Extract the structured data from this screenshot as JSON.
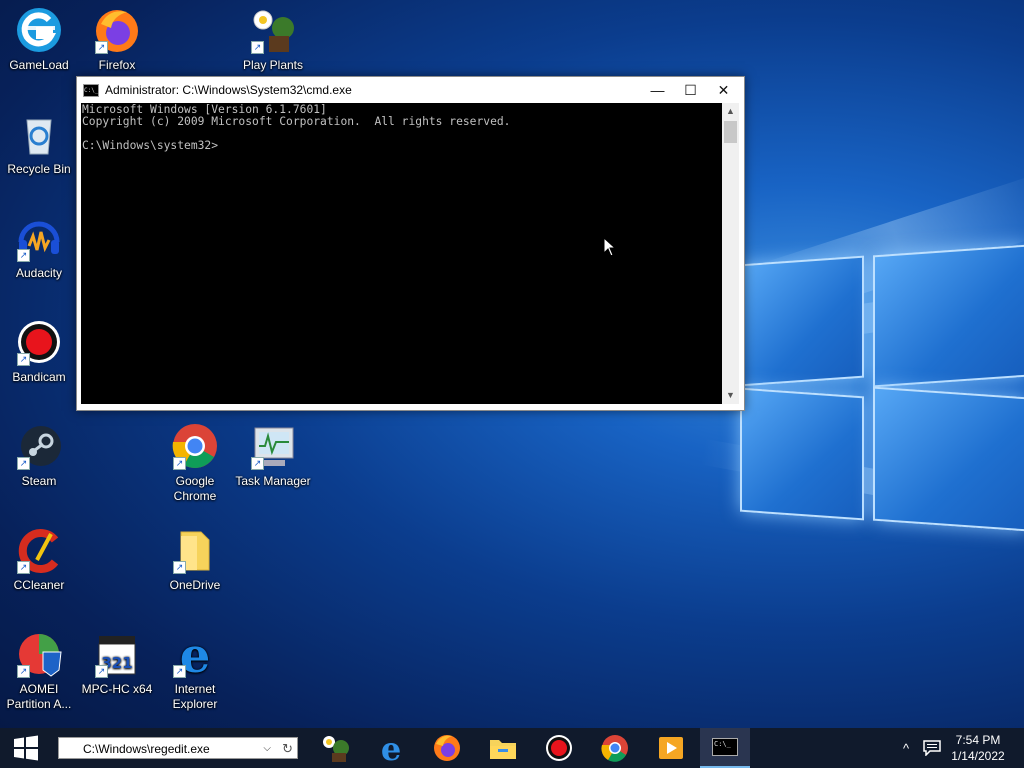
{
  "desktop": {
    "icons": [
      {
        "label": "GameLoad"
      },
      {
        "label": "Firefox"
      },
      {
        "label": "Play Plants vs."
      },
      {
        "label": "Recycle Bin"
      },
      {
        "label": "Audacity"
      },
      {
        "label": "Bandicam"
      },
      {
        "label": "Steam"
      },
      {
        "label": "Google Chrome"
      },
      {
        "label": "Task Manager"
      },
      {
        "label": "CCleaner"
      },
      {
        "label": "OneDrive"
      },
      {
        "label": "AOMEI Partition A..."
      },
      {
        "label": "MPC-HC x64"
      },
      {
        "label": "Internet Explorer"
      }
    ],
    "shortcut_glyph": "↗"
  },
  "cmd_window": {
    "title": "Administrator: C:\\Windows\\System32\\cmd.exe",
    "icon_text": "C:\\_",
    "minimize": "—",
    "maximize": "☐",
    "close": "✕",
    "lines": [
      "Microsoft Windows [Version 6.1.7601]",
      "Copyright (c) 2009 Microsoft Corporation.  All rights reserved.",
      "",
      "C:\\Windows\\system32>"
    ],
    "scroll_up": "▲",
    "scroll_down": "▼"
  },
  "taskbar": {
    "run_value": "C:\\Windows\\regedit.exe",
    "dropdown_glyph": "⌵",
    "refresh_glyph": "↻",
    "apps": [
      "Plants vs. Zombies",
      "Microsoft Edge",
      "Firefox",
      "File Explorer",
      "Bandicam",
      "Google Chrome",
      "MPC-HC",
      "Command Prompt"
    ],
    "cmd_icon_text": "C:\\_",
    "tray_chevron": "^",
    "time": "7:54 PM",
    "date": "1/14/2022"
  },
  "colors": {
    "accent": "#76b9ed",
    "taskbar": "#101a2c",
    "console_bg": "#000000",
    "console_fg": "#c0c0c0"
  }
}
